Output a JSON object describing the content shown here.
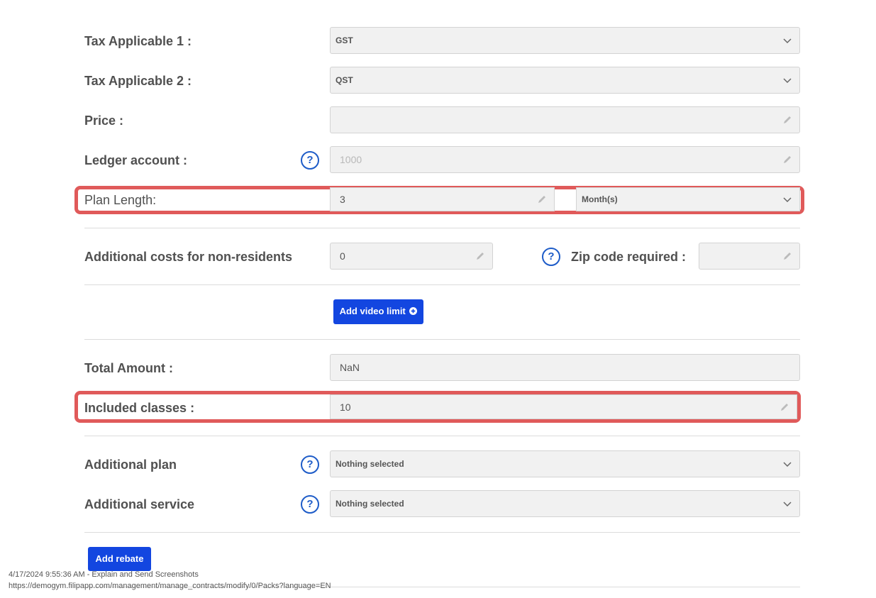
{
  "form": {
    "tax1": {
      "label": "Tax Applicable 1 :",
      "value": "GST"
    },
    "tax2": {
      "label": "Tax Applicable 2 :",
      "value": "QST"
    },
    "price": {
      "label": "Price :",
      "value": ""
    },
    "ledger": {
      "label": "Ledger account :",
      "placeholder": "1000",
      "help": "?"
    },
    "plan_length": {
      "label": "Plan Length:",
      "value": "3",
      "unit": "Month(s)"
    },
    "non_residents": {
      "label": "Additional costs for non-residents",
      "value": "0"
    },
    "zip": {
      "label": "Zip code required :",
      "value": "",
      "help": "?"
    },
    "add_video_limit": {
      "label": "Add video limit"
    },
    "total": {
      "label": "Total Amount :",
      "value": "NaN"
    },
    "included_classes": {
      "label": "Included classes :",
      "value": "10"
    },
    "additional_plan": {
      "label": "Additional plan",
      "value": "Nothing selected",
      "help": "?"
    },
    "additional_service": {
      "label": "Additional service",
      "value": "Nothing selected",
      "help": "?"
    },
    "add_rebate": {
      "label": "Add rebate"
    }
  },
  "footer": {
    "timestamp": "4/17/2024 9:55:36 AM - Explain and Send Screenshots",
    "url": "https://demogym.filipapp.com/management/manage_contracts/modify/0/Packs?language=EN"
  },
  "colors": {
    "accent": "#1346e0",
    "highlight": "#e05a5a",
    "help": "#1e5cc8"
  },
  "icons": [
    "chevron-down-icon",
    "pencil-icon",
    "help-icon",
    "plus-circle-icon"
  ]
}
